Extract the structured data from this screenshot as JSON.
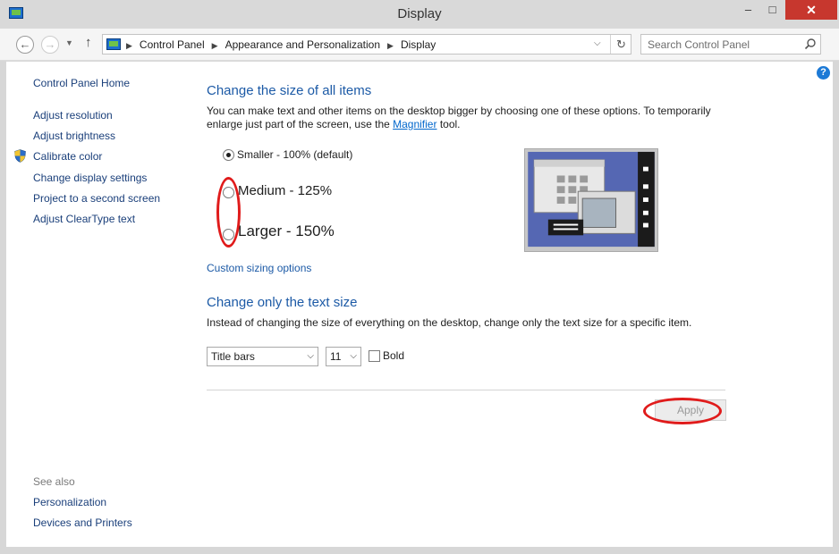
{
  "window": {
    "title": "Display",
    "controls": {
      "minimize": "–",
      "maximize": "□",
      "close": "✕"
    }
  },
  "nav": {
    "back_icon": "back-arrow-icon",
    "forward_icon": "forward-arrow-icon",
    "recent_icon": "chevron-down-icon",
    "up_icon": "up-arrow-icon",
    "breadcrumbs": [
      "Control Panel",
      "Appearance and Personalization",
      "Display"
    ],
    "search_placeholder": "Search Control Panel"
  },
  "sidebar": {
    "home": "Control Panel Home",
    "items": [
      "Adjust resolution",
      "Adjust brightness",
      "Calibrate color",
      "Change display settings",
      "Project to a second screen",
      "Adjust ClearType text"
    ],
    "see_also_label": "See also",
    "see_also": [
      "Personalization",
      "Devices and Printers"
    ]
  },
  "main": {
    "size_heading": "Change the size of all items",
    "size_desc_before": "You can make text and other items on the desktop bigger by choosing one of these options. To temporarily enlarge just part of the screen, use the ",
    "magnifier_link": "Magnifier",
    "size_desc_after": " tool.",
    "options": [
      {
        "label": "Smaller - 100% (default)",
        "checked": true
      },
      {
        "label": "Medium - 125%",
        "checked": false
      },
      {
        "label": "Larger - 150%",
        "checked": false
      }
    ],
    "custom_link": "Custom sizing options",
    "text_heading": "Change only the text size",
    "text_desc": "Instead of changing the size of everything on the desktop, change only the text size for a specific item.",
    "item_select": "Title bars",
    "size_select": "11",
    "bold_label": "Bold",
    "apply_label": "Apply"
  },
  "colors": {
    "heading": "#1c5aa6",
    "link": "#1a3f7a",
    "annotation": "#e01b1b",
    "close": "#c7372e"
  }
}
